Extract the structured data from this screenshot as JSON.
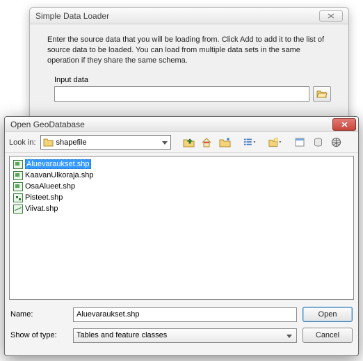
{
  "wizard": {
    "title": "Simple Data Loader",
    "instruction": "Enter the source data that you will be loading from. Click Add to add it to the list of source data to be loaded. You can load from multiple data sets in the same operation if they share the same schema.",
    "input_label": "Input data",
    "input_value": ""
  },
  "dialog": {
    "title": "Open GeoDatabase",
    "lookin_label": "Look in:",
    "lookin_value": "shapefile",
    "files": [
      {
        "name": "Aluevaraukset.shp",
        "geom": "poly",
        "selected": true
      },
      {
        "name": "KaavanUlkoraja.shp",
        "geom": "poly",
        "selected": false
      },
      {
        "name": "OsaAlueet.shp",
        "geom": "poly",
        "selected": false
      },
      {
        "name": "Pisteet.shp",
        "geom": "point",
        "selected": false
      },
      {
        "name": "Viivat.shp",
        "geom": "line",
        "selected": false
      }
    ],
    "name_label": "Name:",
    "name_value": "Aluevaraukset.shp",
    "type_label": "Show of type:",
    "type_value": "Tables and feature classes",
    "open_label": "Open",
    "cancel_label": "Cancel"
  }
}
